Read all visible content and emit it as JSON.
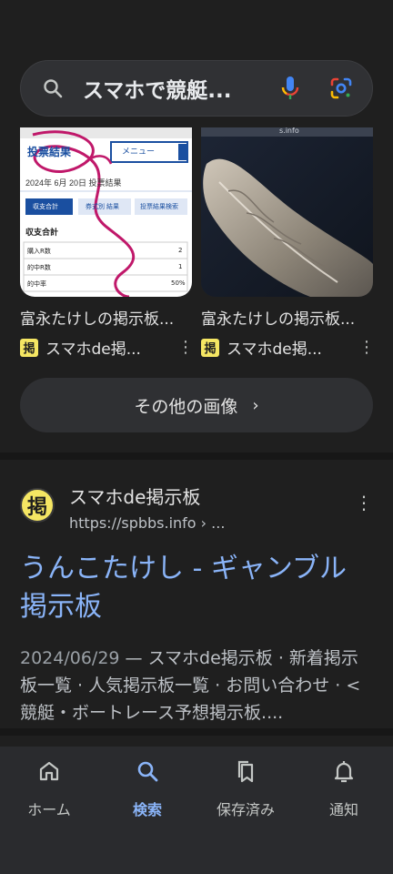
{
  "search": {
    "query": "スマホで競艇..."
  },
  "images": {
    "items": [
      {
        "title": "富永たけしの掲示板...",
        "source_badge": "掲",
        "source": "スマホde掲...",
        "thumb_heading": "投票結果",
        "thumb_menu": "メニュー",
        "thumb_date": "2024年 6月 20日 投票結果",
        "thumb_tabs": [
          "収支合計",
          "券式別 結果",
          "投票結果検索"
        ],
        "thumb_section": "収支合計",
        "thumb_rows": [
          {
            "label": "購入R数",
            "value": "2"
          },
          {
            "label": "的中R数",
            "value": "1"
          },
          {
            "label": "的中率",
            "value": "50%"
          }
        ]
      },
      {
        "title": "富永たけしの掲示板...",
        "source_badge": "掲",
        "source": "スマホde掲...",
        "thumb_caption": "s.info"
      }
    ],
    "more_label": "その他の画像",
    "more_chevron": "›"
  },
  "result": {
    "favicon": "掲",
    "site": "スマホde掲示板",
    "url": "https://spbbs.info › ...",
    "title": "うんこたけし - ギャンブル掲示板",
    "date": "2024/06/29",
    "snippet": " — スマホde掲示板 · 新着掲示板一覧 · 人気掲示板一覧 · お問い合わせ · < 競艇・ボートレース予想掲示板...."
  },
  "nav": {
    "items": [
      {
        "label": "ホーム",
        "icon": "home-icon"
      },
      {
        "label": "検索",
        "icon": "search-icon",
        "active": true
      },
      {
        "label": "保存済み",
        "icon": "saved-icon"
      },
      {
        "label": "通知",
        "icon": "bell-icon"
      }
    ]
  },
  "colors": {
    "background": "#1f1f1f",
    "link": "#8ab4f8",
    "active_nav": "#8ab4f8",
    "badge": "#f5e663"
  }
}
